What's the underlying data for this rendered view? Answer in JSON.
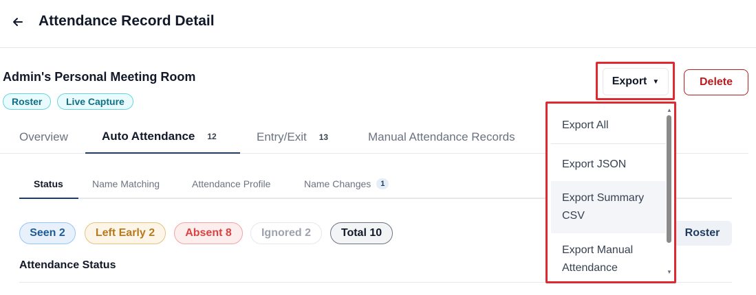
{
  "header": {
    "title": "Attendance Record Detail",
    "back_icon": "arrow-left-icon"
  },
  "meeting": {
    "title": "Admin's Personal Meeting Room",
    "tags": [
      "Roster",
      "Live Capture"
    ]
  },
  "actions": {
    "export_label": "Export",
    "delete_label": "Delete",
    "delete_color": "#b91c1c"
  },
  "tabs": [
    {
      "label": "Overview",
      "count": ""
    },
    {
      "label": "Auto Attendance",
      "count": "12"
    },
    {
      "label": "Entry/Exit",
      "count": "13"
    },
    {
      "label": "Manual Attendance Records",
      "count": ""
    }
  ],
  "subtabs": [
    {
      "label": "Status",
      "count": ""
    },
    {
      "label": "Name Matching",
      "count": ""
    },
    {
      "label": "Attendance Profile",
      "count": ""
    },
    {
      "label": "Name Changes",
      "count": "1"
    }
  ],
  "filters": [
    {
      "label": "Seen 2"
    },
    {
      "label": "Left Early 2"
    },
    {
      "label": "Absent 8"
    },
    {
      "label": "Ignored 2"
    },
    {
      "label": "Total 10"
    }
  ],
  "roster_button": "Roster",
  "section_title": "Attendance Status",
  "export_menu": {
    "items": [
      "Export All",
      "Export JSON",
      "Export Summary CSV",
      "Export Manual Attendance"
    ]
  },
  "colors": {
    "highlight": "#e0282f",
    "accent": "#1f3a5f",
    "tag": "#0e6f86"
  }
}
